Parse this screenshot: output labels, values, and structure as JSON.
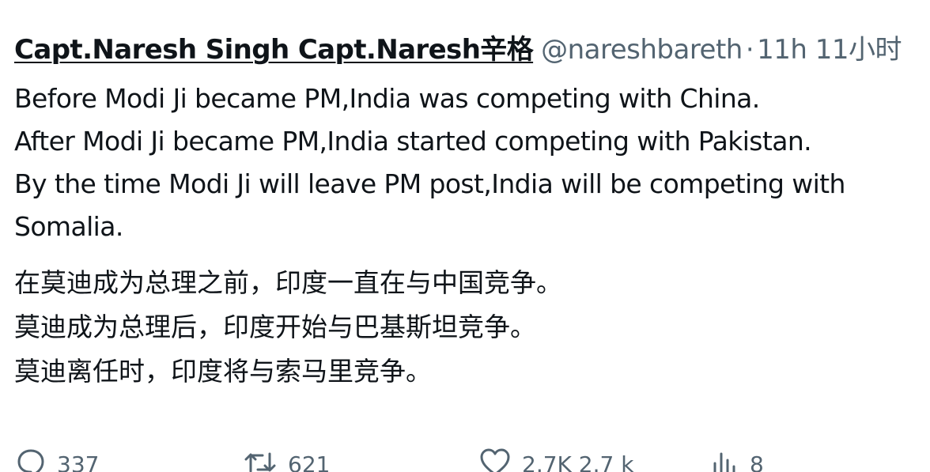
{
  "tweet": {
    "display_name": "Capt.Naresh Singh Capt.Naresh辛格",
    "handle": "@nareshbareth",
    "separator": "·",
    "time": "11h 11小时",
    "text_en": [
      "Before Modi Ji became PM,India was competing with China.",
      "After Modi Ji became PM,India started competing with Pakistan.",
      "By the time Modi Ji will leave PM post,India will be competing with",
      "Somalia."
    ],
    "text_zh": [
      "在莫迪成为总理之前，印度一直在与中国竞争。",
      "莫迪成为总理后，印度开始与巴基斯坦竞争。",
      "莫迪离任时，印度将与索马里竞争。"
    ],
    "actions": {
      "reply": {
        "icon": "reply-icon",
        "count": "337"
      },
      "retweet": {
        "icon": "retweet-icon",
        "count": "621"
      },
      "like": {
        "icon": "heart-icon",
        "count": "2.7K 2.7 k"
      },
      "views": {
        "icon": "views-chart-icon",
        "count": "8"
      }
    }
  },
  "colors": {
    "text": "#0f1419",
    "secondary": "#536471",
    "background": "#ffffff"
  }
}
